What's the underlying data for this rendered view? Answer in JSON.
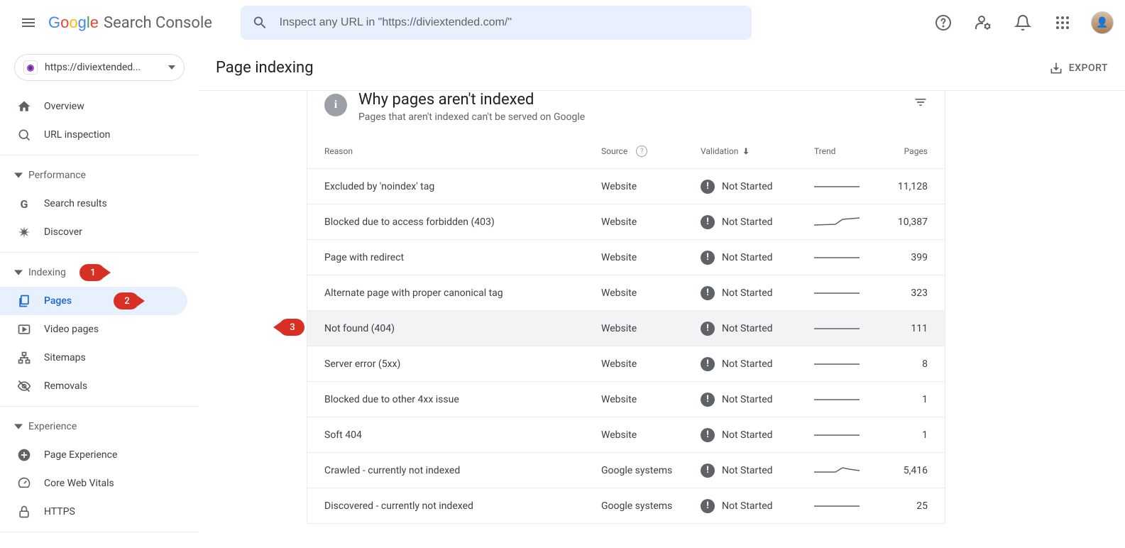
{
  "header": {
    "product_name": "Search Console",
    "search_placeholder": "Inspect any URL in \"https://diviextended.com/\""
  },
  "property": {
    "label": "https://diviextended..."
  },
  "sidebar": {
    "items": {
      "overview": "Overview",
      "url_inspection": "URL inspection",
      "search_results": "Search results",
      "discover": "Discover",
      "pages": "Pages",
      "video_pages": "Video pages",
      "sitemaps": "Sitemaps",
      "removals": "Removals",
      "page_experience": "Page Experience",
      "core_web_vitals": "Core Web Vitals",
      "https": "HTTPS"
    },
    "sections": {
      "performance": "Performance",
      "indexing": "Indexing",
      "experience": "Experience"
    }
  },
  "content": {
    "title": "Page indexing",
    "export": "EXPORT",
    "card_title": "Why pages aren't indexed",
    "card_subtitle": "Pages that aren't indexed can't be served on Google",
    "columns": {
      "reason": "Reason",
      "source": "Source",
      "validation": "Validation",
      "trend": "Trend",
      "pages": "Pages"
    },
    "rows": [
      {
        "reason": "Excluded by 'noindex' tag",
        "source": "Website",
        "validation": "Not Started",
        "pages": "11,128",
        "spark": "flat"
      },
      {
        "reason": "Blocked due to access forbidden (403)",
        "source": "Website",
        "validation": "Not Started",
        "pages": "10,387",
        "spark": "up"
      },
      {
        "reason": "Page with redirect",
        "source": "Website",
        "validation": "Not Started",
        "pages": "399",
        "spark": "flat"
      },
      {
        "reason": "Alternate page with proper canonical tag",
        "source": "Website",
        "validation": "Not Started",
        "pages": "323",
        "spark": "flat"
      },
      {
        "reason": "Not found (404)",
        "source": "Website",
        "validation": "Not Started",
        "pages": "111",
        "spark": "flat",
        "highlighted": true
      },
      {
        "reason": "Server error (5xx)",
        "source": "Website",
        "validation": "Not Started",
        "pages": "8",
        "spark": "flat"
      },
      {
        "reason": "Blocked due to other 4xx issue",
        "source": "Website",
        "validation": "Not Started",
        "pages": "1",
        "spark": "flat"
      },
      {
        "reason": "Soft 404",
        "source": "Website",
        "validation": "Not Started",
        "pages": "1",
        "spark": "flat"
      },
      {
        "reason": "Crawled - currently not indexed",
        "source": "Google systems",
        "validation": "Not Started",
        "pages": "5,416",
        "spark": "bump"
      },
      {
        "reason": "Discovered - currently not indexed",
        "source": "Google systems",
        "validation": "Not Started",
        "pages": "25",
        "spark": "flat"
      }
    ]
  },
  "badges": {
    "b1": "1",
    "b2": "2",
    "b3": "3"
  }
}
